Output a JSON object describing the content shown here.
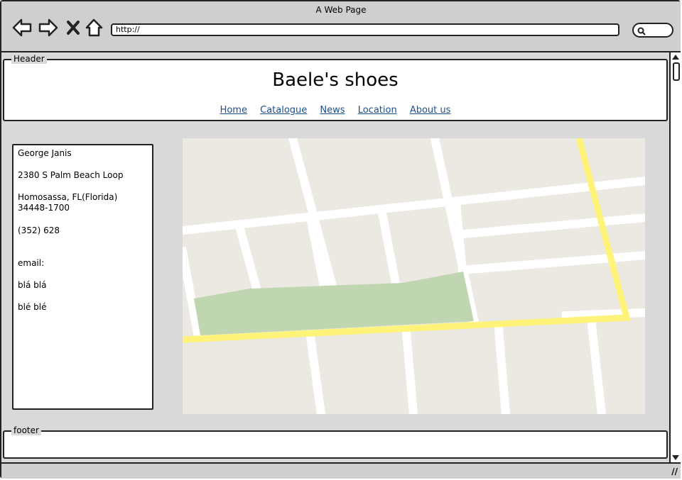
{
  "window": {
    "title": "A Web Page",
    "url": "http://"
  },
  "header": {
    "group_label": "Header",
    "site_title": "Baele's shoes",
    "nav": [
      {
        "label": "Home"
      },
      {
        "label": "Catalogue"
      },
      {
        "label": "News"
      },
      {
        "label": "Location"
      },
      {
        "label": "About us"
      }
    ]
  },
  "contact": {
    "name": "George Janis",
    "street": "2380 S Palm Beach Loop",
    "city": "Homosassa, FL(Florida)",
    "zip": "34448-1700",
    "phone": "(352) 628",
    "email_label": "email:",
    "line1": "blá blá",
    "line2": "blé blé"
  },
  "map": {
    "land_color": "#ebe9e2",
    "road_color": "#ffffff",
    "highway_color": "#fff37a",
    "park_color": "#c0d6b0"
  },
  "footer": {
    "group_label": "footer"
  },
  "icons": [
    "back-arrow-icon",
    "forward-arrow-icon",
    "close-icon",
    "home-icon",
    "search-icon",
    "resize-grip-icon"
  ]
}
